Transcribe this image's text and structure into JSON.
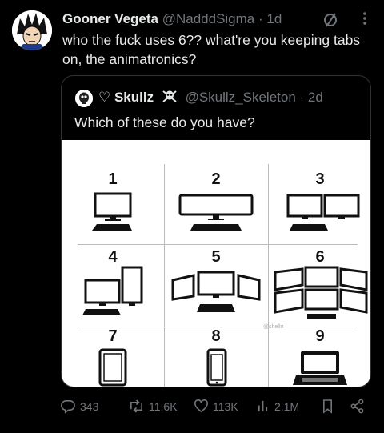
{
  "tweet": {
    "display_name": "Gooner Vegeta",
    "handle": "@NadddSigma",
    "dot": "·",
    "time": "1d",
    "text": "who the fuck uses 6?? what're you keeping tabs on, the animatronics?"
  },
  "quoted": {
    "display_name": "♡ Skullz",
    "handle": "@Skullz_Skeleton",
    "dot": "·",
    "time": "2d",
    "text": "Which of these do you have?",
    "grid_labels": [
      "1",
      "2",
      "3",
      "4",
      "5",
      "6",
      "7",
      "8",
      "9"
    ],
    "watermark": "@shello"
  },
  "actions": {
    "replies": "343",
    "reposts": "11.6K",
    "likes": "113K",
    "views": "2.1M"
  },
  "colors": {
    "background": "#000000",
    "text": "#e7e9ea",
    "muted": "#71767b",
    "border": "#2f3336"
  }
}
